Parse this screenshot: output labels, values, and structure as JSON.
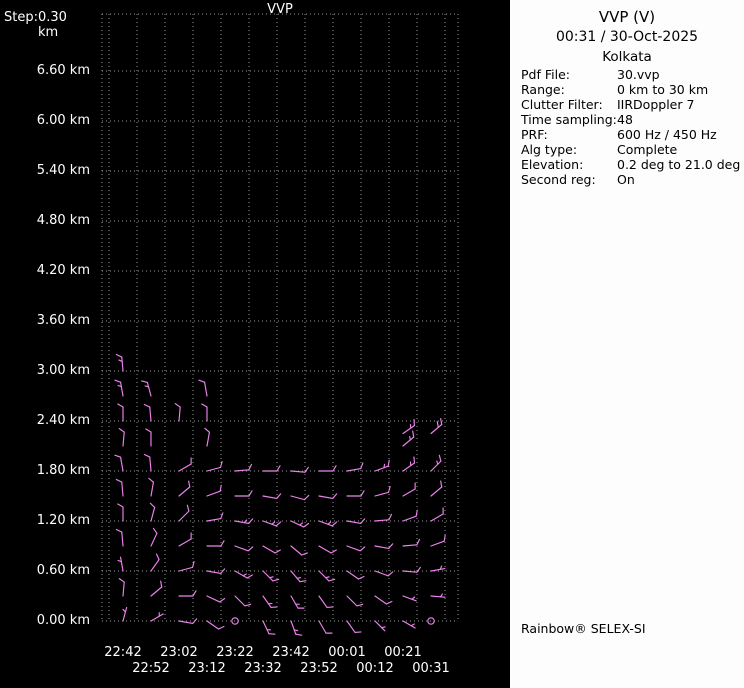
{
  "plot": {
    "title": "VVP",
    "step_label": "Step:",
    "step_value": "0.30 km"
  },
  "panel": {
    "title": "VVP (V)",
    "datetime": "00:31 / 30-Oct-2025",
    "site": "Kolkata",
    "fields": [
      {
        "label": "Pdf File:",
        "value": "30.vvp"
      },
      {
        "label": "Range:",
        "value": "0 km to 30 km"
      },
      {
        "label": "Clutter Filter:",
        "value": "IIRDoppler 7"
      },
      {
        "label": "Time sampling:",
        "value": "48"
      },
      {
        "label": "PRF:",
        "value": "600 Hz / 450 Hz"
      },
      {
        "label": "Alg type:",
        "value": "Complete"
      },
      {
        "label": "Elevation:",
        "value": "0.2 deg to 21.0 deg"
      },
      {
        "label": "Second reg:",
        "value": "On"
      }
    ],
    "footer": "Rainbow® SELEX-SI"
  },
  "chart_data": {
    "type": "wind_barb_time_height_profile",
    "title": "VVP",
    "ylabel_unit": "km",
    "height_step_km": 0.3,
    "y_tick_labels": [
      "6.60 km",
      "6.00 km",
      "5.40 km",
      "4.80 km",
      "4.20 km",
      "3.60 km",
      "3.00 km",
      "2.40 km",
      "1.80 km",
      "1.20 km",
      "0.60 km",
      "0.00 km"
    ],
    "y_tick_values_km": [
      6.6,
      6.0,
      5.4,
      4.8,
      4.2,
      3.6,
      3.0,
      2.4,
      1.8,
      1.2,
      0.6,
      0.0
    ],
    "x_times": [
      "22:42",
      "22:52",
      "23:02",
      "23:12",
      "23:22",
      "23:32",
      "23:42",
      "23:52",
      "00:01",
      "00:12",
      "00:21",
      "00:31"
    ],
    "grid": true,
    "barb_color": "#EE82EE",
    "barb_rows": [
      {
        "h": 1.8,
        "dirs": [
          350,
          355,
          60,
          75,
          85,
          90,
          95,
          90,
          80,
          70,
          55,
          45
        ],
        "spds": [
          10,
          10,
          10,
          10,
          10,
          10,
          10,
          10,
          10,
          15,
          15,
          15
        ]
      },
      {
        "h": 1.5,
        "dirs": [
          355,
          10,
          50,
          70,
          90,
          100,
          105,
          100,
          90,
          75,
          60,
          50
        ],
        "spds": [
          10,
          10,
          10,
          10,
          10,
          10,
          10,
          10,
          10,
          10,
          10,
          10
        ]
      },
      {
        "h": 1.2,
        "dirs": [
          0,
          15,
          45,
          80,
          100,
          110,
          115,
          110,
          100,
          85,
          70,
          60
        ],
        "spds": [
          10,
          10,
          10,
          10,
          15,
          15,
          15,
          15,
          10,
          10,
          10,
          10
        ]
      },
      {
        "h": 0.9,
        "dirs": [
          355,
          25,
          60,
          90,
          110,
          120,
          130,
          120,
          110,
          100,
          85,
          70
        ],
        "spds": [
          10,
          10,
          10,
          10,
          10,
          10,
          10,
          10,
          10,
          10,
          10,
          10
        ]
      },
      {
        "h": 0.6,
        "dirs": [
          350,
          35,
          75,
          100,
          120,
          135,
          140,
          135,
          125,
          110,
          95,
          80
        ],
        "spds": [
          5,
          10,
          10,
          10,
          15,
          15,
          15,
          15,
          10,
          10,
          10,
          5
        ]
      },
      {
        "h": 0.3,
        "dirs": [
          5,
          50,
          90,
          115,
          135,
          145,
          150,
          145,
          135,
          125,
          110,
          95
        ],
        "spds": [
          10,
          10,
          10,
          10,
          10,
          15,
          15,
          10,
          10,
          10,
          5,
          5
        ]
      },
      {
        "h": 0.0,
        "dirs": [
          15,
          60,
          100,
          125,
          null,
          155,
          160,
          150,
          145,
          135,
          120,
          null
        ],
        "spds": [
          5,
          5,
          10,
          10,
          null,
          15,
          15,
          10,
          10,
          5,
          5,
          null
        ]
      }
    ],
    "extra_barbs": [
      [
        0,
        3.0,
        355,
        15
      ],
      [
        0,
        2.7,
        350,
        15
      ],
      [
        0,
        2.4,
        0,
        10
      ],
      [
        0,
        2.1,
        5,
        10
      ],
      [
        1,
        2.7,
        345,
        15
      ],
      [
        1,
        2.4,
        355,
        10
      ],
      [
        1,
        2.1,
        0,
        10
      ],
      [
        2,
        2.4,
        5,
        10
      ],
      [
        3,
        2.7,
        350,
        10
      ],
      [
        3,
        2.4,
        0,
        10
      ],
      [
        3,
        2.1,
        10,
        10
      ],
      [
        10,
        2.1,
        50,
        15
      ],
      [
        10,
        2.25,
        55,
        15
      ],
      [
        11,
        2.25,
        50,
        20
      ]
    ],
    "calm_points": [
      {
        "col": 4,
        "time": "23:22",
        "height_km": 0.0
      },
      {
        "col": 11,
        "time": "00:31",
        "height_km": 0.0
      }
    ]
  }
}
